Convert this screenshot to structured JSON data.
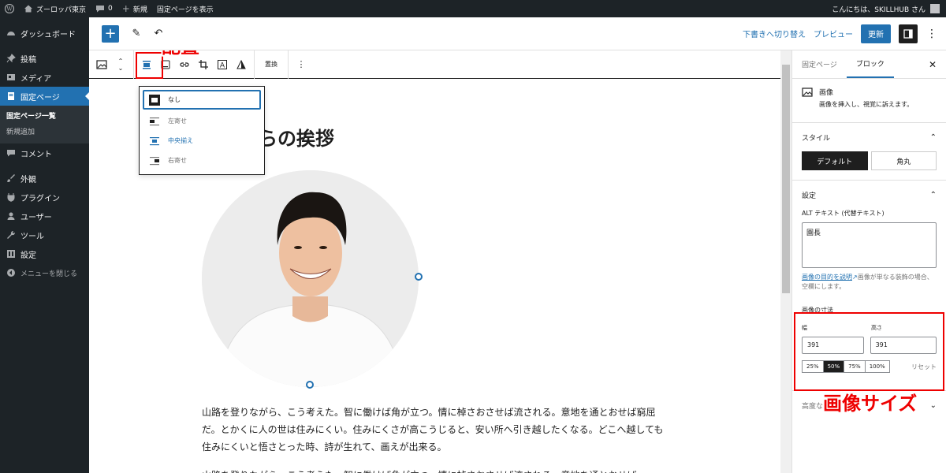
{
  "admin_bar": {
    "site_name": "ズーロッパ東京",
    "comments": "0",
    "new": "新規",
    "view_page": "固定ページを表示",
    "greeting": "こんにちは、SKILLHUB さん"
  },
  "sidebar": {
    "items": [
      {
        "label": "ダッシュボード",
        "icon": "dashboard-icon"
      },
      {
        "label": "投稿",
        "icon": "pin-icon"
      },
      {
        "label": "メディア",
        "icon": "media-icon"
      },
      {
        "label": "固定ページ",
        "icon": "page-icon"
      },
      {
        "label": "コメント",
        "icon": "comment-icon"
      },
      {
        "label": "外観",
        "icon": "brush-icon"
      },
      {
        "label": "プラグイン",
        "icon": "plugin-icon"
      },
      {
        "label": "ユーザー",
        "icon": "user-icon"
      },
      {
        "label": "ツール",
        "icon": "wrench-icon"
      },
      {
        "label": "設定",
        "icon": "settings-icon"
      },
      {
        "label": "メニューを閉じる",
        "icon": "collapse-icon"
      }
    ],
    "sub": {
      "all_pages": "固定ページ一覧",
      "add_new": "新規追加"
    }
  },
  "topbar": {
    "save_draft": "下書きへ切り替え",
    "preview": "プレビュー",
    "update": "更新"
  },
  "block_toolbar": {
    "replace": "置換"
  },
  "align_menu": {
    "none": "なし",
    "left": "左寄せ",
    "center": "中央揃え",
    "right": "右寄せ"
  },
  "annotations": {
    "align": "配置",
    "image_size": "画像サイズ"
  },
  "content": {
    "heading": "らの挨拶",
    "paragraph": "山路を登りながら、こう考えた。智に働けば角が立つ。情に棹さおさせば流される。意地を通とおせば窮屈だ。とかくに人の世は住みにくい。住みにくさが高こうじると、安い所へ引き越したくなる。どこへ越しても住みにくいと悟さとった時、詩が生れて、画えが出来る。",
    "paragraph2": "山路を登りながら、こう考えた。智に働けば角が立つ。情に棹さおさせば流される。意地を通とおせば"
  },
  "inspector": {
    "tab_page": "固定ページ",
    "tab_block": "ブロック",
    "block_name": "画像",
    "block_desc": "画像を挿入し、視覚に訴えます。",
    "styles_title": "スタイル",
    "style_default": "デフォルト",
    "style_rounded": "角丸",
    "settings_title": "設定",
    "alt_label": "ALT テキスト (代替テキスト)",
    "alt_value": "園長",
    "alt_link": "画像の目的を説明",
    "alt_help": "画像が単なる装飾の場合、空欄にします。",
    "dims_title": "画像の寸法",
    "width_label": "幅",
    "height_label": "高さ",
    "width_value": "391",
    "height_value": "391",
    "pcts": [
      "25%",
      "50%",
      "75%",
      "100%"
    ],
    "pct_selected": "50%",
    "reset": "リセット",
    "advanced": "高度な設定"
  }
}
